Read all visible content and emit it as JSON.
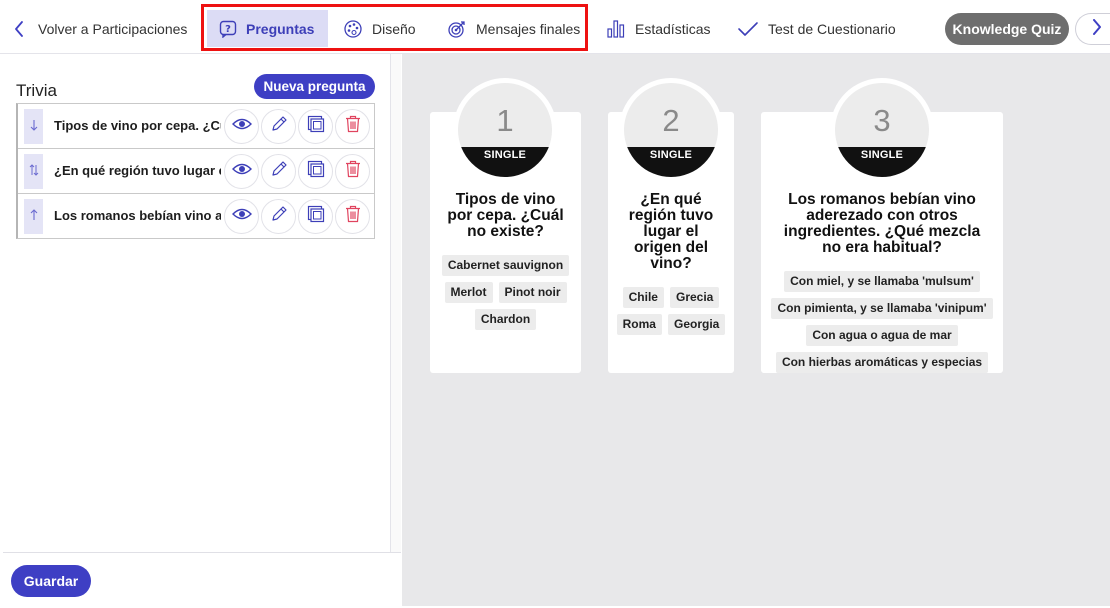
{
  "nav": {
    "back_label": "Volver a Participaciones",
    "tabs": [
      {
        "label": "Preguntas",
        "icon": "question-bubble-icon",
        "active": true
      },
      {
        "label": "Diseño",
        "icon": "palette-icon",
        "active": false
      },
      {
        "label": "Mensajes finales",
        "icon": "target-icon",
        "active": false
      },
      {
        "label": "Estadísticas",
        "icon": "bar-chart-icon",
        "active": false
      },
      {
        "label": "Test de Cuestionario",
        "icon": "checkmark-icon",
        "active": false
      }
    ],
    "quiz_name": "Knowledge Quiz",
    "accent_color": "#3e3fc4",
    "highlight_color": "#ee1111"
  },
  "sidebar": {
    "title": "Trivia",
    "new_question_label": "Nueva pregunta",
    "save_label": "Guardar",
    "questions": [
      {
        "text": "Tipos de vino por cepa. ¿Cuál no existe?",
        "handle_icon": "arrow-down-icon"
      },
      {
        "text": "¿En qué región tuvo lugar el origen del vino?",
        "handle_icon": "arrow-updown-icon"
      },
      {
        "text": "Los romanos bebían vino aderezado con otros ingredientes. ¿Qué mezcla no era habitual?",
        "handle_icon": "arrow-up-icon"
      }
    ]
  },
  "cards": [
    {
      "number": "1",
      "type_label": "SINGLE",
      "question": "Tipos de vino por cepa. ¿Cuál no existe?",
      "answers": [
        "Cabernet sauvignon",
        "Merlot",
        "Pinot noir",
        "Chardon"
      ]
    },
    {
      "number": "2",
      "type_label": "SINGLE",
      "question": "¿En qué región tuvo lugar el origen del vino?",
      "answers": [
        "Chile",
        "Grecia",
        "Roma",
        "Georgia"
      ]
    },
    {
      "number": "3",
      "type_label": "SINGLE",
      "question": "Los romanos bebían vino aderezado con otros ingredientes. ¿Qué mezcla no era habitual?",
      "answers": [
        "Con miel, y se llamaba 'mulsum'",
        "Con pimienta, y se llamaba 'vinipum'",
        "Con agua o agua de mar",
        "Con hierbas aromáticas y especias"
      ]
    }
  ]
}
